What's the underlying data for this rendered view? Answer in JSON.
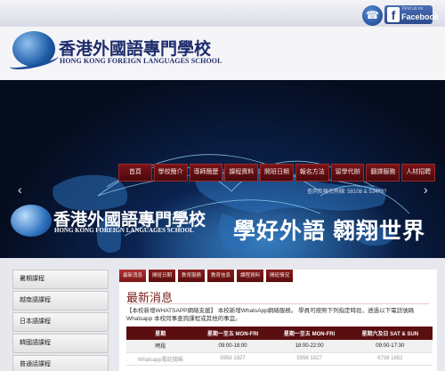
{
  "topbar": {
    "phone_icon": "phone-icon",
    "facebook": {
      "small": "Find us on",
      "label": "Facebook"
    }
  },
  "logo": {
    "name_cn": "香港外國語專門學校",
    "name_en": "HONG KONG FOREIGN LANGUAGES SCHOOL"
  },
  "nav": {
    "items": [
      "首頁",
      "學校簡介",
      "導師簡歷",
      "課程資料",
      "開班日期",
      "報名方法",
      "留學代辦",
      "翻譯服務",
      "人材招聘"
    ]
  },
  "banner": {
    "contact": "查詢及報名熱線: 58108 & 53473?",
    "name_cn": "香港外國語專門學校",
    "name_en": "HONG KONG FOREIGN LANGUAGES SCHOOL",
    "slogan": "學好外語 翱翔世界",
    "prev": "‹",
    "next": "›"
  },
  "sidebar": {
    "items": [
      "暑期課程",
      "越南語課程",
      "日本語課程",
      "韓國語課程",
      "普通話課程"
    ]
  },
  "main": {
    "tabs": [
      "最新消息",
      "開班日期",
      "教育服務",
      "教育信息",
      "課程資料",
      "開班情況"
    ],
    "news_title": "最新消息",
    "news_text": "【本校新增WHATSAPP網絡支援】 本校新增WhatsApp網絡服務。 學員可按照下列指定時段，透過以下電話號碼Whatsapp 本校同事查詢課程或其他的事宜。",
    "table": {
      "headers": [
        "星期",
        "星期一至五 MON-FRI",
        "星期一至五 MON-FRI",
        "星期六及日 SAT & SUN"
      ],
      "rows": [
        [
          "時段",
          "09:00-18:00",
          "18:00-22:00",
          "09:00-17:30"
        ],
        [
          "Whatsapp電話號碼",
          "5958 1827",
          "5958 1827",
          "6738 1852"
        ]
      ]
    }
  }
}
